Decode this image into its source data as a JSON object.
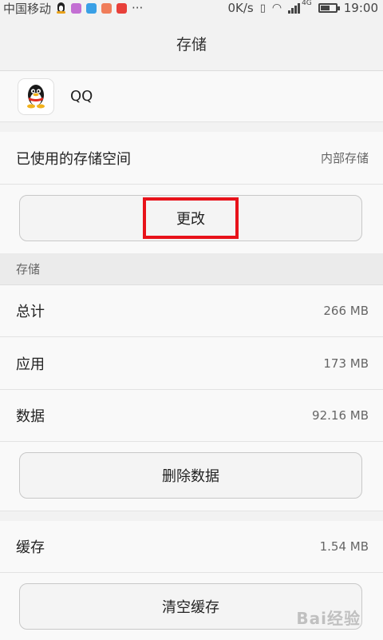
{
  "status_bar": {
    "carrier": "中国移动",
    "more": "···",
    "speed": "0K/s",
    "network": "4G",
    "time": "19:00",
    "battery_level": 0.55
  },
  "header": {
    "title": "存储"
  },
  "app": {
    "name": "QQ"
  },
  "storage_used": {
    "label": "已使用的存储空间",
    "value": "内部存储"
  },
  "change_button": {
    "label": "更改"
  },
  "storage_section": {
    "header": "存储",
    "rows": [
      {
        "label": "总计",
        "value": "266 MB"
      },
      {
        "label": "应用",
        "value": "173 MB"
      },
      {
        "label": "数据",
        "value": "92.16 MB"
      }
    ]
  },
  "clear_data_button": {
    "label": "删除数据"
  },
  "cache": {
    "label": "缓存",
    "value": "1.54 MB"
  },
  "clear_cache_button": {
    "label": "清空缓存"
  },
  "watermark": "Bai经验",
  "colors": {
    "highlight": "#e8121a",
    "background": "#f2f2f2"
  }
}
